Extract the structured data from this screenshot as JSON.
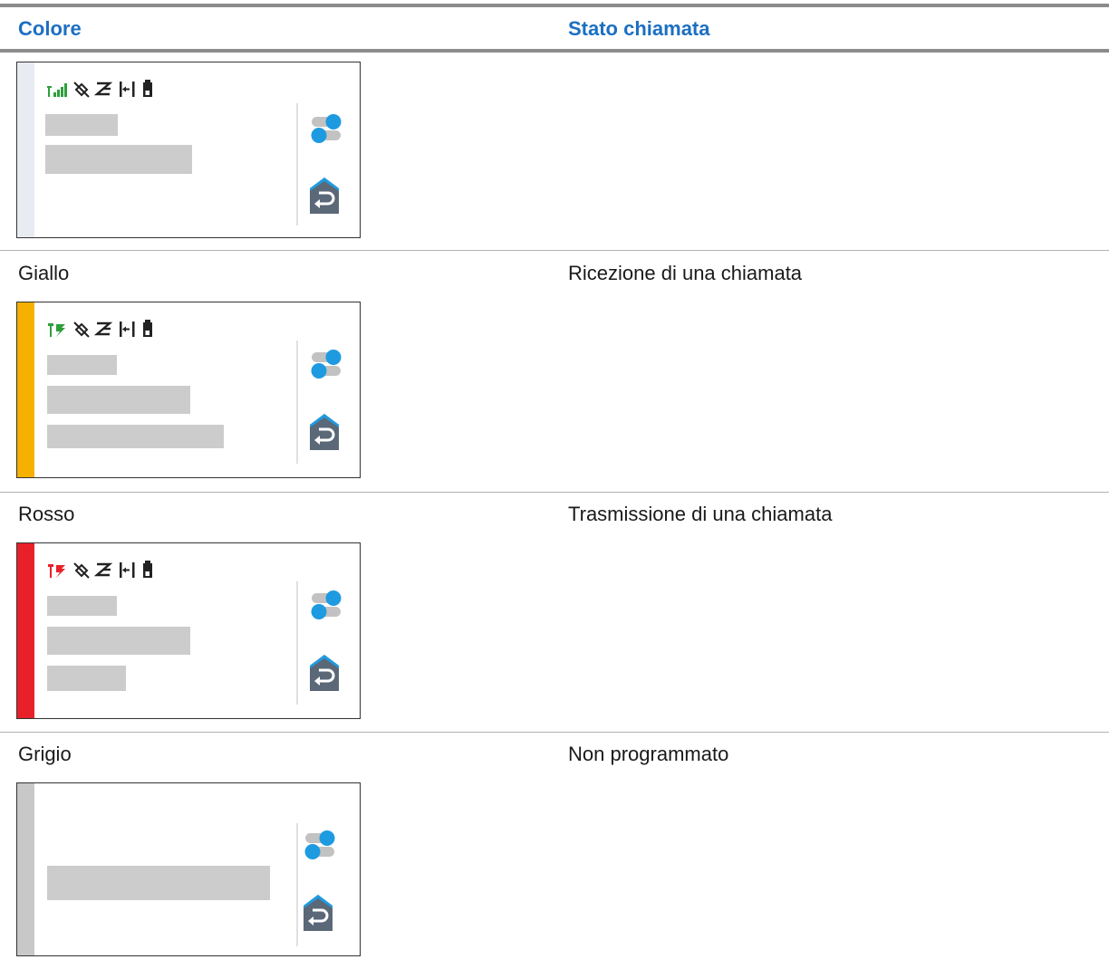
{
  "table": {
    "headers": {
      "color": "Colore",
      "state": "Stato chiamata"
    },
    "rows": [
      {
        "color_label": "",
        "state_label": "",
        "strip_color": "#e8ecf2",
        "signal": "bars",
        "placeholders": 2
      },
      {
        "color_label": "Giallo",
        "state_label": "Ricezione di una chiamata",
        "strip_color": "#f5b000",
        "signal": "rx",
        "placeholders": 3
      },
      {
        "color_label": "Rosso",
        "state_label": "Trasmissione di una chiamata",
        "strip_color": "#e8202a",
        "signal": "tx",
        "placeholders": 3
      },
      {
        "color_label": "Grigio",
        "state_label": "Non programmato",
        "strip_color": "#c8c8c8",
        "signal": "none",
        "placeholders": 1
      }
    ]
  },
  "icons": {
    "status_icons": [
      "signal-icon",
      "no-gps-icon",
      "scan-icon",
      "talkaround-icon",
      "battery-icon"
    ],
    "side_icons": [
      "settings-toggle-icon",
      "home-back-icon"
    ]
  },
  "colors": {
    "header_text": "#1c6fc1",
    "accent_blue": "#1e9be0",
    "icon_slate": "#5a6878"
  }
}
